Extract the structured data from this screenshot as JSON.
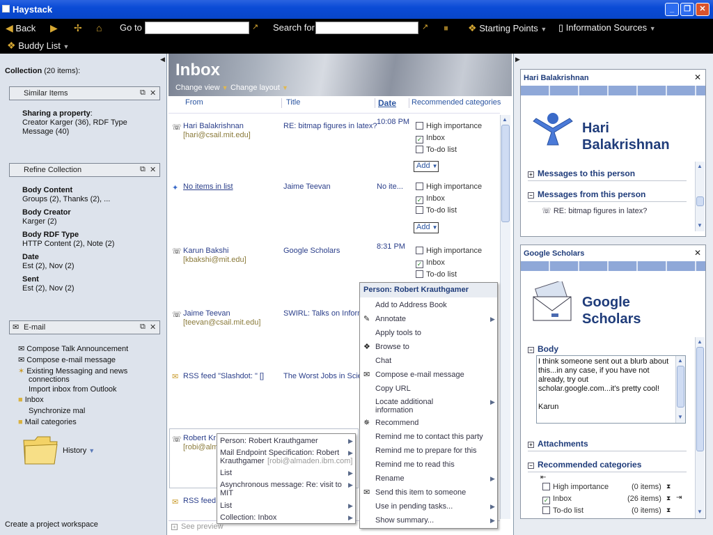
{
  "window": {
    "title": "Haystack"
  },
  "toolbar": {
    "back": "Back",
    "goto": "Go to",
    "search": "Search for",
    "starting_points": "Starting Points",
    "information_sources": "Information Sources",
    "buddy_list": "Buddy List"
  },
  "left": {
    "collection": "Collection",
    "collection_count": "(20 items):",
    "similar_items": "Similar Items",
    "sharing_label": "Sharing a property",
    "sharing_values": "Creator Karger (36), RDF Type",
    "sharing_values2": "Message (40)",
    "refine": "Refine Collection",
    "facets": [
      {
        "name": "Body Content",
        "values": "Groups (2), Thanks (2), ..."
      },
      {
        "name": "Body Creator",
        "values": "Karger (2)"
      },
      {
        "name": "Body RDF Type",
        "values": "HTTP Content (2), Note (2)"
      },
      {
        "name": "Date",
        "values": "Est (2), Nov (2)"
      },
      {
        "name": "Sent",
        "values": "Est (2), Nov (2)"
      }
    ],
    "email": "E-mail",
    "email_items": [
      "Compose Talk Announcement",
      "Compose e-mail message",
      "Existing Messaging and news",
      "connections",
      "Import inbox from Outlook",
      "Inbox",
      "Synchronize mal",
      "Mail categories"
    ],
    "history": "History",
    "footer": "Create a project workspace"
  },
  "inbox": {
    "title": "Inbox",
    "change_view": "Change view",
    "change_layout": "Change layout",
    "columns": {
      "from": "From",
      "title": "Title",
      "date": "Date",
      "categories": "Recommended categories"
    },
    "categories": [
      "High importance",
      "Inbox",
      "To-do list"
    ],
    "add": "Add",
    "rows": [
      {
        "from": "Hari Balakrishnan",
        "email": "[hari@csail.mit.edu]",
        "title": "RE: bitmap figures in latex?",
        "date": "10:08 PM"
      },
      {
        "from": "No items in list",
        "email": "",
        "title": "Jaime Teevan",
        "date": "No ite..."
      },
      {
        "from": "Karun Bakshi",
        "email": "[kbakshi@mit.edu]",
        "title": "Google Scholars",
        "date": "8:31 PM"
      },
      {
        "from": "Jaime Teevan",
        "email": "[teevan@csail.mit.edu]",
        "title": "SWIRL: Talks on Inform",
        "date": ""
      },
      {
        "from": "RSS feed \"Slashdot: \" []",
        "email": "",
        "title": "The Worst Jobs in Scie",
        "date": ""
      },
      {
        "from": "Robert Kr",
        "email": "[robi@alm",
        "title": "",
        "date": ""
      },
      {
        "from": "RSS feed",
        "email": "",
        "title": "",
        "date": ""
      }
    ],
    "see_preview": "See preview"
  },
  "context_menu": {
    "header": "Person: Robert Krauthgamer",
    "items": [
      "Add to Address Book",
      "Annotate",
      "Apply tools to",
      "Browse to",
      "Chat",
      "Compose e-mail message",
      "Copy URL",
      "Locate additional",
      "information",
      "Recommend",
      "Remind me to contact this party",
      "Remind me to prepare for this",
      "Remind me to read this",
      "Rename",
      "Send this item to someone",
      "Use in pending tasks...",
      "Show summary..."
    ]
  },
  "sub_menu": {
    "items": [
      "Person: Robert Krauthgamer",
      "Mail Endpoint Specification: Robert",
      "Krauthgamer",
      "[robi@almaden.ibm.com]",
      "List",
      "Asynchronous message: Re: visit to",
      "MIT",
      "List",
      "Collection: Inbox"
    ]
  },
  "person_card": {
    "title": "Hari Balakrishnan",
    "first": "Hari",
    "last": "Balakrishnan",
    "messages_to": "Messages to this person",
    "messages_from": "Messages from this person",
    "message_item": "RE: bitmap figures in latex?"
  },
  "scholar_card": {
    "title": "Google Scholars",
    "name1": "Google",
    "name2": "Scholars",
    "body_label": "Body",
    "body_lines": [
      "I think someone sent out a blurb about",
      "this...in any case, if you have not",
      "already, try out",
      "scholar.google.com...it's pretty cool!",
      "",
      "Karun"
    ],
    "attachments": "Attachments",
    "rec_cats": "Recommended categories",
    "cats": [
      {
        "name": "High importance",
        "count": "(0 items)",
        "checked": false
      },
      {
        "name": "Inbox",
        "count": "(26 items)",
        "checked": true
      },
      {
        "name": "To-do list",
        "count": "(0 items)",
        "checked": false
      }
    ]
  },
  "colors": {
    "accent": "#1f3c7a",
    "link": "#2a3e8a",
    "titlebar": "#0a4bd6"
  }
}
